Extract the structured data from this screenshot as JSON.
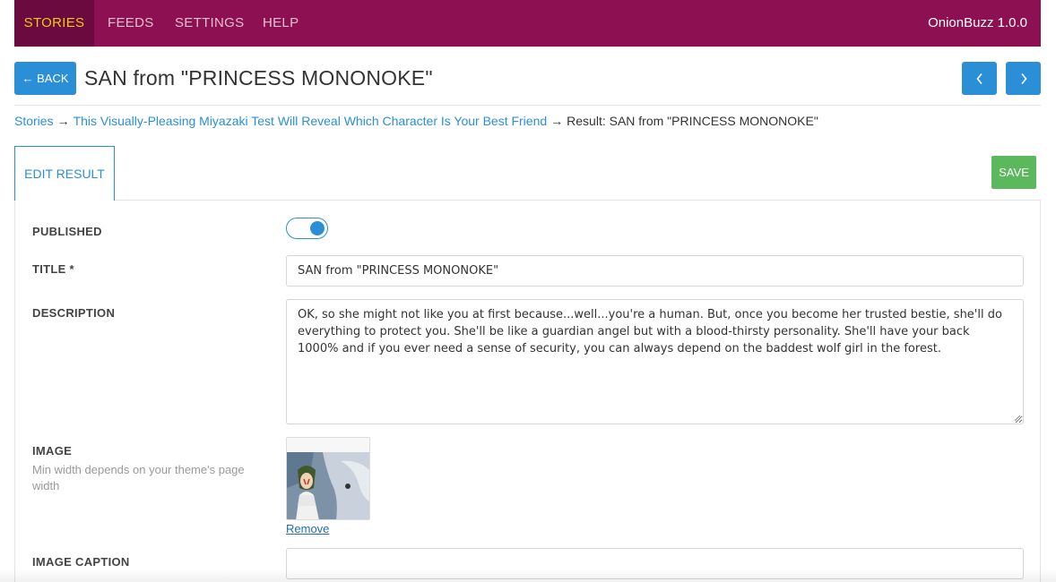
{
  "nav": {
    "items": [
      {
        "label": "STORIES",
        "active": true
      },
      {
        "label": "FEEDS",
        "active": false
      },
      {
        "label": "SETTINGS",
        "active": false
      },
      {
        "label": "HELP",
        "active": false
      }
    ],
    "brand": "OnionBuzz 1.0.0"
  },
  "header": {
    "back_label": "← BACK",
    "title": "SAN from \"PRINCESS MONONOKE\"",
    "prev_icon": "chevron-left-icon",
    "next_icon": "chevron-right-icon"
  },
  "breadcrumb": {
    "root": "Stories",
    "arrow": "→",
    "story": "This Visually-Pleasing Miyazaki Test Will Reveal Which Character Is Your Best Friend",
    "current": "Result: SAN from \"PRINCESS MONONOKE\""
  },
  "tabs": {
    "edit_label": "EDIT RESULT"
  },
  "save_label": "SAVE",
  "form": {
    "published": {
      "label": "PUBLISHED",
      "value": true
    },
    "title": {
      "label": "TITLE *",
      "value": "SAN from \"PRINCESS MONONOKE\""
    },
    "description": {
      "label": "DESCRIPTION",
      "value": "OK, so she might not like you at first because...well...you're a human. But, once you become her trusted bestie, she'll do everything to protect you. She'll be like a guardian angel but with a blood-thirsty personality. She'll have your back 1000% and if you ever need a sense of security, you can always depend on the baddest wolf girl in the forest."
    },
    "image": {
      "label": "IMAGE",
      "help": "Min width depends on your theme's page width",
      "remove_label": "Remove"
    },
    "image_caption": {
      "label": "IMAGE CAPTION",
      "value": ""
    }
  },
  "colors": {
    "nav_bg": "#8c1052",
    "nav_active_bg": "#6a0a3e",
    "nav_active_text": "#f5c518",
    "accent": "#2b8fd8",
    "save": "#5cb85c"
  }
}
